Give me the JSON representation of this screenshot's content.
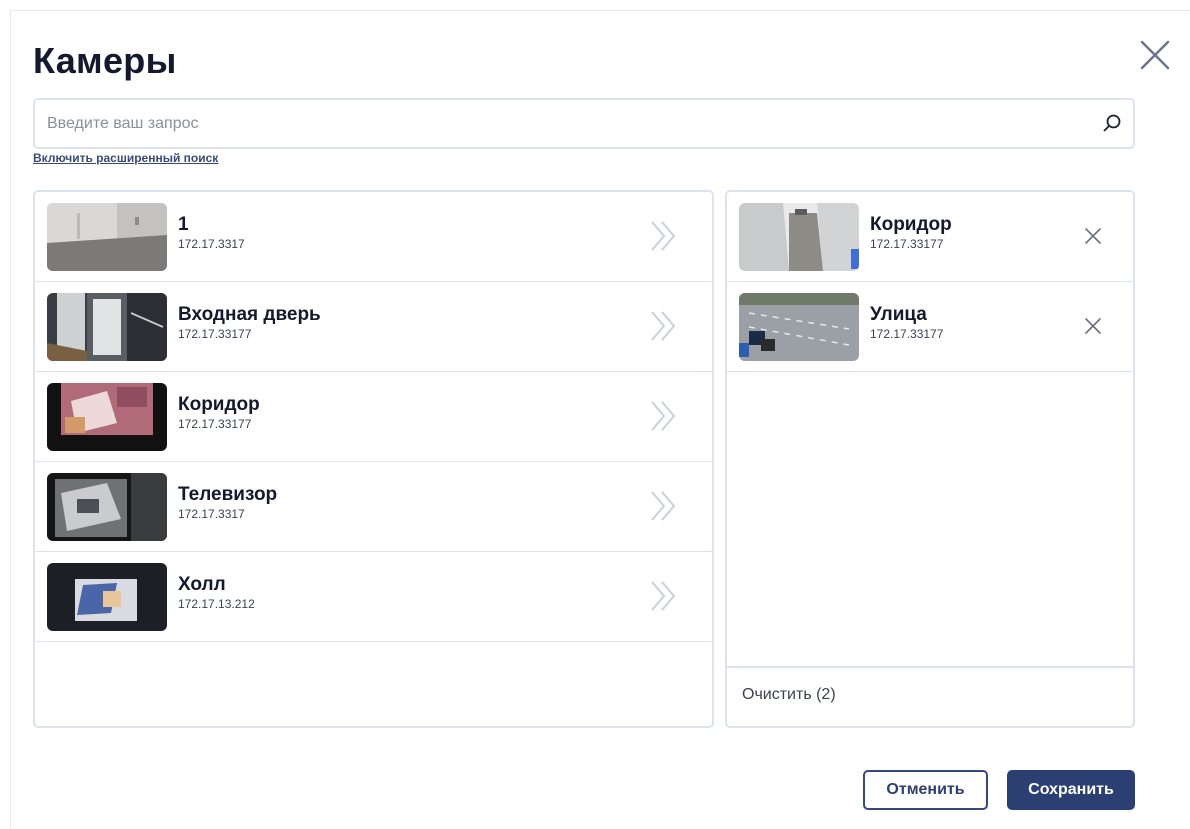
{
  "dialog": {
    "title": "Камеры",
    "close_icon": "close-icon"
  },
  "search": {
    "placeholder": "Введите ваш запрос",
    "value": "",
    "icon": "search-icon",
    "advanced_link": "Включить расширенный поиск"
  },
  "available": {
    "add_icon": "double-chevron-right-icon",
    "items": [
      {
        "name": "1",
        "ip": "172.17.3317",
        "thumb": "office-corner"
      },
      {
        "name": "Входная дверь",
        "ip": "172.17.33177",
        "thumb": "entrance-door"
      },
      {
        "name": "Коридор",
        "ip": "172.17.33177",
        "thumb": "pink-room"
      },
      {
        "name": "Телевизор",
        "ip": "172.17.3317",
        "thumb": "tv-room"
      },
      {
        "name": "Холл",
        "ip": "172.17.13.212",
        "thumb": "hall"
      }
    ]
  },
  "selected": {
    "remove_icon": "close-icon",
    "items": [
      {
        "name": "Коридор",
        "ip": "172.17.33177",
        "thumb": "corridor-fisheye"
      },
      {
        "name": "Улица",
        "ip": "172.17.33177",
        "thumb": "street"
      }
    ],
    "clear_label": "Очистить (2)"
  },
  "footer": {
    "cancel_label": "Отменить",
    "save_label": "Сохранить"
  },
  "colors": {
    "primary": "#2c3f73",
    "border": "#dde3ee",
    "chevron": "#c9cfdb"
  }
}
